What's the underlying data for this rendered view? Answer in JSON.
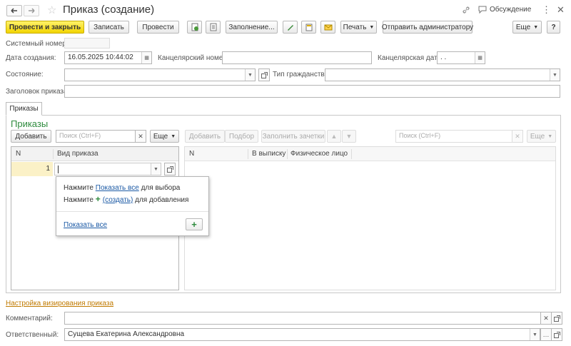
{
  "window": {
    "title": "Приказ (создание)",
    "discussion_label": "Обсуждение"
  },
  "toolbar": {
    "post_close": "Провести и закрыть",
    "save": "Записать",
    "post": "Провести",
    "fill": "Заполнение...",
    "print": "Печать",
    "send_admin": "Отправить администратору",
    "more": "Еще",
    "help": "?"
  },
  "form": {
    "system_number_label": "Системный номер:",
    "system_number_value": "",
    "created_label": "Дата создания:",
    "created_value": "16.05.2025 10:44:02",
    "office_number_label": "Канцелярский номер:",
    "office_number_value": "",
    "office_date_label": "Канцелярская дата:",
    "office_date_value": " .  .",
    "state_label": "Состояние:",
    "state_value": "",
    "citizenship_label": "Тип гражданства:",
    "citizenship_value": "",
    "header_label": "Заголовок приказа:",
    "header_value": ""
  },
  "tabs": [
    {
      "label": "Приказы"
    }
  ],
  "orders": {
    "section_title": "Приказы",
    "add": "Добавить",
    "search_placeholder": "Поиск (Ctrl+F)",
    "more": "Еще",
    "columns": [
      "N",
      "Вид приказа"
    ],
    "rows": [
      {
        "n": "1",
        "type": ""
      }
    ]
  },
  "popup": {
    "line1_prefix": "Нажмите ",
    "line1_link": "Показать все",
    "line1_suffix": " для выбора",
    "line2_prefix": "Нажмите ",
    "line2_link": "(создать)",
    "line2_suffix": " для добавления",
    "show_all": "Показать все"
  },
  "persons": {
    "add": "Добавить",
    "pick": "Подбор",
    "fill_records": "Заполнить зачетки",
    "search_placeholder": "Поиск (Ctrl+F)",
    "more": "Еще",
    "columns": [
      "N",
      "В выписку",
      "Физическое лицо"
    ]
  },
  "footer": {
    "approval_link": "Настройка визирования приказа",
    "comment_label": "Комментарий:",
    "comment_value": "",
    "responsible_label": "Ответственный:",
    "responsible_value": "Сущева Екатерина Александровна"
  },
  "colors": {
    "accent_green": "#2e8b3e",
    "primary_yellow": "#f2d400",
    "link_blue": "#1c5aa5",
    "approval_link": "#c07a00"
  }
}
